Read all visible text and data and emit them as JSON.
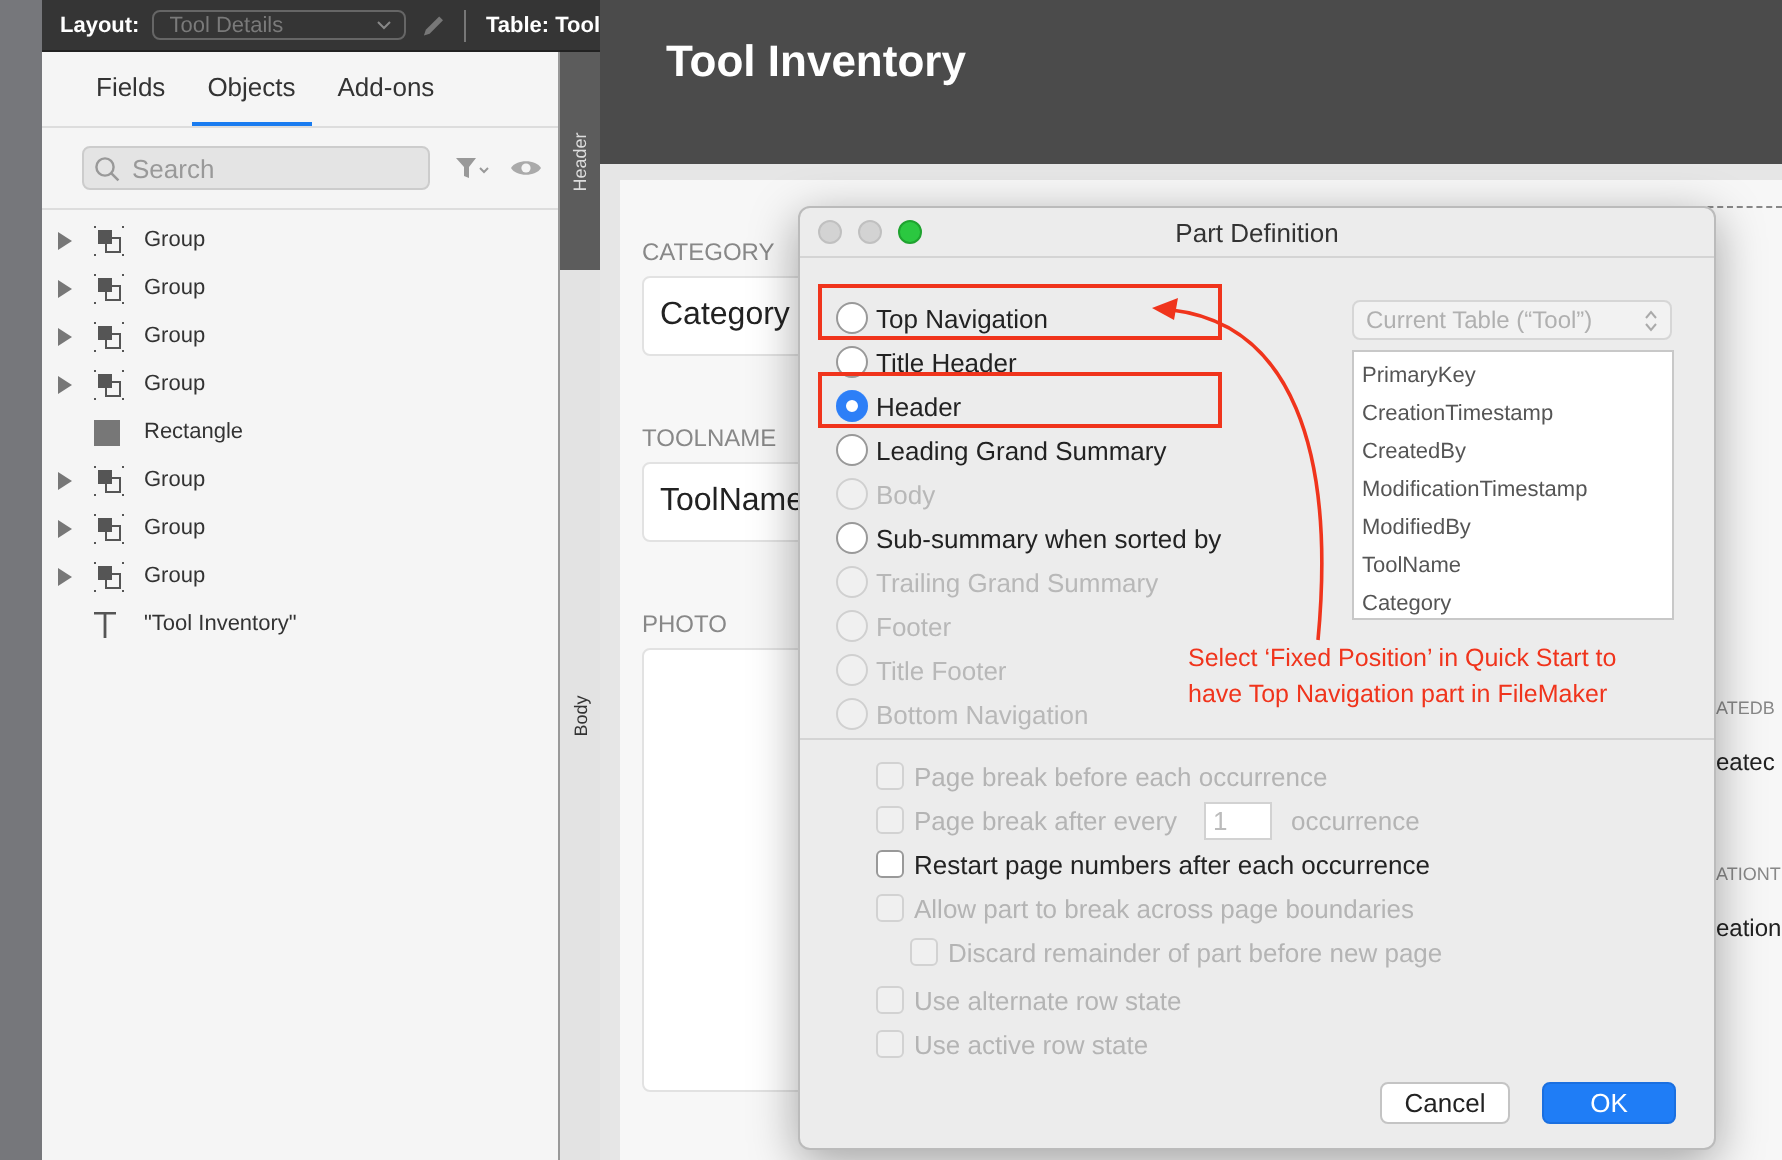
{
  "toolbar": {
    "layout_label": "Layout:",
    "layout_value": "Tool Details",
    "table_label": "Table: Tool"
  },
  "sidebar": {
    "tabs": [
      {
        "label": "Fields",
        "selected": false
      },
      {
        "label": "Objects",
        "selected": true
      },
      {
        "label": "Add-ons",
        "selected": false
      }
    ],
    "search": {
      "placeholder": "Search"
    },
    "objects": [
      {
        "kind": "group",
        "label": "Group"
      },
      {
        "kind": "group",
        "label": "Group"
      },
      {
        "kind": "group",
        "label": "Group"
      },
      {
        "kind": "group",
        "label": "Group"
      },
      {
        "kind": "rectangle",
        "label": "Rectangle"
      },
      {
        "kind": "group",
        "label": "Group"
      },
      {
        "kind": "group",
        "label": "Group"
      },
      {
        "kind": "group",
        "label": "Group"
      },
      {
        "kind": "text",
        "label": "\"Tool Inventory\""
      }
    ]
  },
  "parts": [
    {
      "kind": "header",
      "label": "Header"
    },
    {
      "kind": "body",
      "label": "Body"
    }
  ],
  "layout": {
    "title": "Tool Inventory",
    "fields": [
      {
        "label": "CATEGORY",
        "value": "Category"
      },
      {
        "label": "TOOLNAME",
        "value": "ToolName"
      },
      {
        "label": "PHOTO",
        "kind": "container"
      }
    ],
    "right_fields": [
      {
        "label": "ATEDB",
        "value": "eatec"
      },
      {
        "label": "ATIONT",
        "value": "eation"
      }
    ]
  },
  "dialog": {
    "title": "Part Definition",
    "part_types": [
      {
        "label": "Top Navigation",
        "selected": false,
        "disabled": false,
        "highlighted": true
      },
      {
        "label": "Title Header",
        "selected": false,
        "disabled": false,
        "highlighted": false
      },
      {
        "label": "Header",
        "selected": true,
        "disabled": false,
        "highlighted": true
      },
      {
        "label": "Leading Grand Summary",
        "selected": false,
        "disabled": false,
        "highlighted": false
      },
      {
        "label": "Body",
        "selected": false,
        "disabled": true,
        "highlighted": false
      },
      {
        "label": "Sub-summary when sorted by",
        "selected": false,
        "disabled": false,
        "highlighted": false
      },
      {
        "label": "Trailing Grand Summary",
        "selected": false,
        "disabled": true,
        "highlighted": false
      },
      {
        "label": "Footer",
        "selected": false,
        "disabled": true,
        "highlighted": false
      },
      {
        "label": "Title Footer",
        "selected": false,
        "disabled": true,
        "highlighted": false
      },
      {
        "label": "Bottom Navigation",
        "selected": false,
        "disabled": true,
        "highlighted": false
      }
    ],
    "table_popup": {
      "value": "Current Table (“Tool”)",
      "disabled": true
    },
    "table_fields": [
      "PrimaryKey",
      "CreationTimestamp",
      "CreatedBy",
      "ModificationTimestamp",
      "ModifiedBy",
      "ToolName",
      "Category"
    ],
    "options": [
      {
        "kind": "plain",
        "label": "Page break before each occurrence",
        "checked": false,
        "disabled": true
      },
      {
        "kind": "count",
        "label": "Page break after every",
        "value": "1",
        "suffix": "occurrence",
        "checked": false,
        "disabled": true
      },
      {
        "kind": "plain",
        "label": "Restart page numbers after each occurrence",
        "checked": false,
        "disabled": false
      },
      {
        "kind": "plain",
        "label": "Allow part to break across page boundaries",
        "checked": false,
        "disabled": true,
        "children": [
          {
            "kind": "plain",
            "label": "Discard remainder of part before new page",
            "checked": false,
            "disabled": true
          }
        ]
      },
      {
        "kind": "plain",
        "label": "Use alternate row state",
        "checked": false,
        "disabled": true
      },
      {
        "kind": "plain",
        "label": "Use active row state",
        "checked": false,
        "disabled": true
      }
    ],
    "buttons": [
      {
        "label": "Cancel",
        "default": false
      },
      {
        "label": "OK",
        "default": true
      }
    ]
  },
  "annotation": {
    "lines": [
      "Select ‘Fixed Position’ in Quick Start to",
      "have Top Navigation part in FileMaker"
    ]
  }
}
